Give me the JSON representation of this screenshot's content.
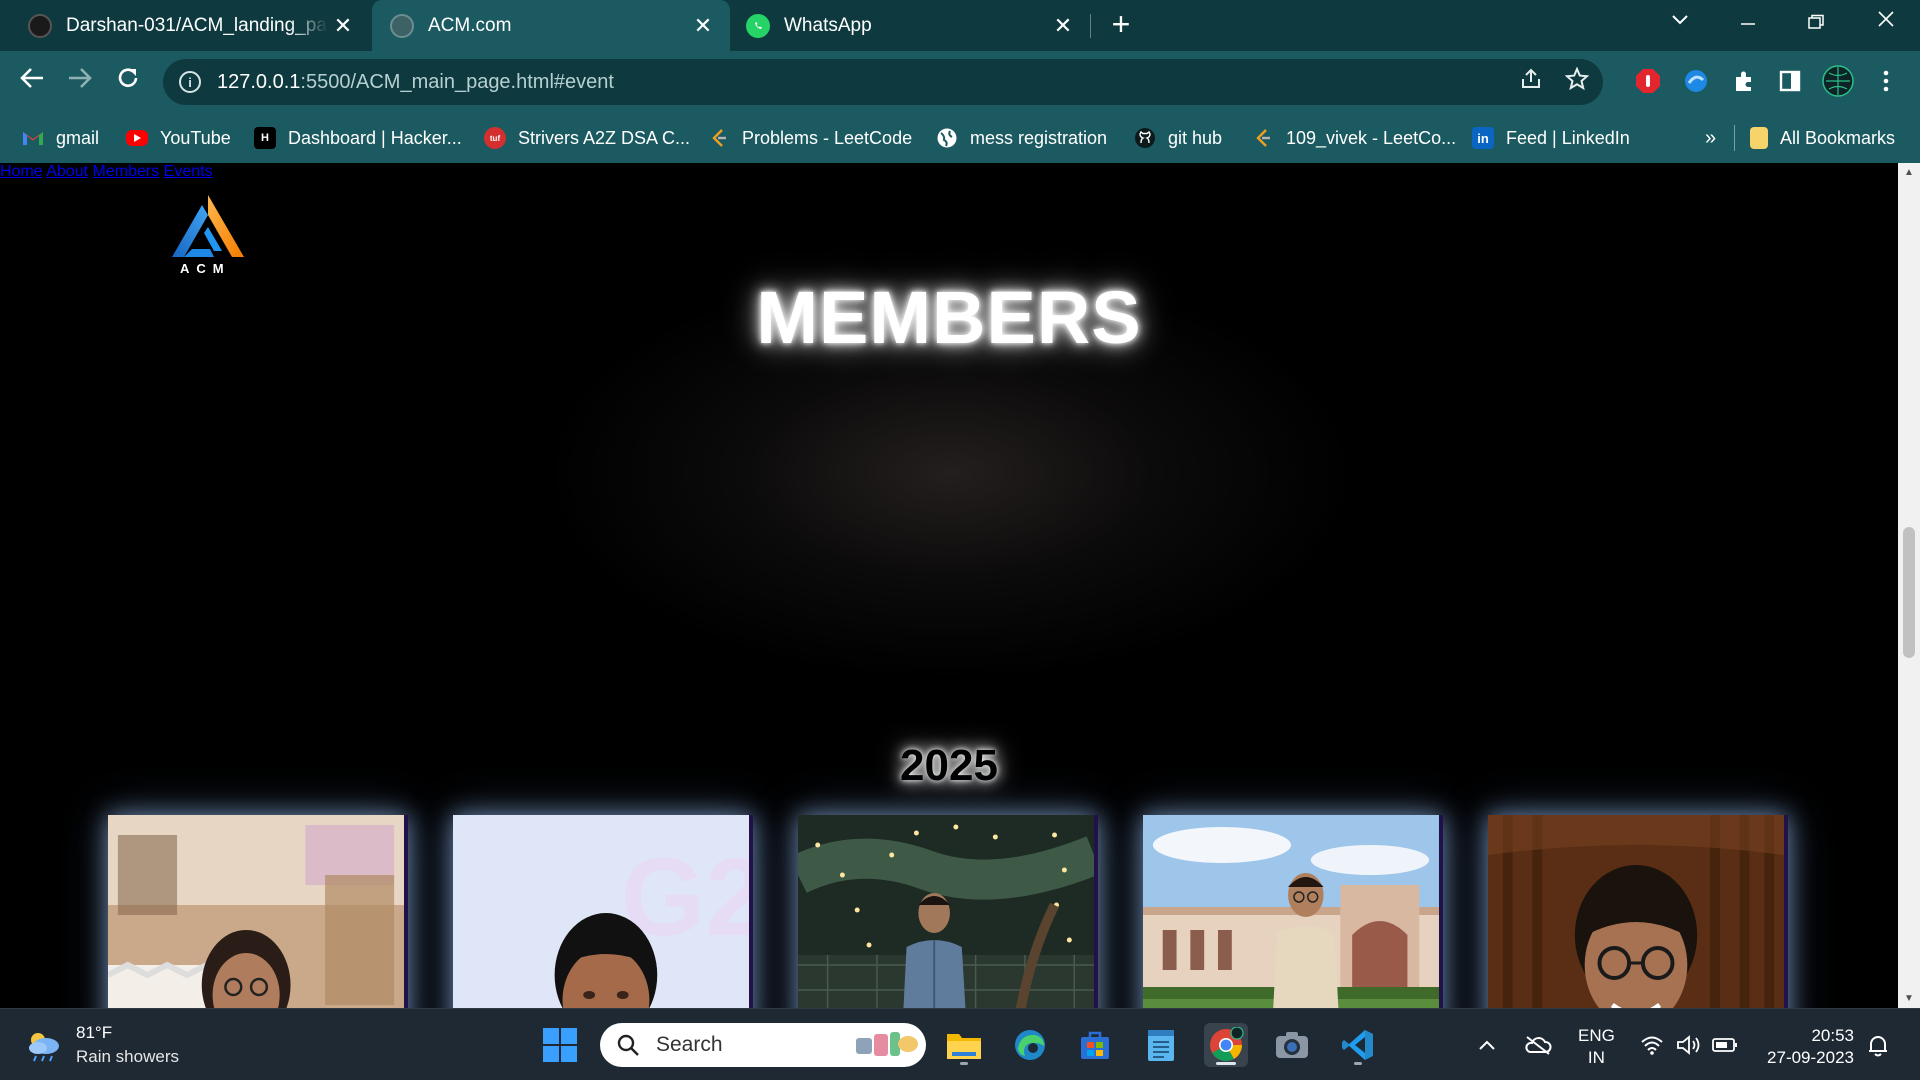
{
  "browser": {
    "tabs": [
      {
        "title": "Darshan-031/ACM_landing_page",
        "close": "✕",
        "active": false
      },
      {
        "title": "ACM.com",
        "close": "✕",
        "active": true
      },
      {
        "title": "WhatsApp",
        "close": "✕",
        "active": false
      }
    ],
    "new_tab": "+",
    "address": {
      "host": "127.0.0.1",
      "path": ":5500/ACM_main_page.html#event"
    },
    "bookmarks": [
      {
        "label": "gmail",
        "icon": "gmail-icon"
      },
      {
        "label": "YouTube",
        "icon": "youtube-icon"
      },
      {
        "label": "Dashboard | Hacker...",
        "icon": "hackerrank-icon"
      },
      {
        "label": "Strivers A2Z DSA C...",
        "icon": "tuf-icon"
      },
      {
        "label": "Problems - LeetCode",
        "icon": "leetcode-icon"
      },
      {
        "label": "mess registration",
        "icon": "globe-icon"
      },
      {
        "label": "git hub",
        "icon": "github-icon"
      },
      {
        "label": "109_vivek - LeetCo...",
        "icon": "leetcode-icon"
      },
      {
        "label": "Feed | LinkedIn",
        "icon": "linkedin-icon"
      }
    ],
    "more_bookmarks": "»",
    "all_bookmarks": "All Bookmarks"
  },
  "site": {
    "logo_text": "ACM",
    "nav": [
      "Home",
      "About",
      "Members",
      "Events"
    ],
    "section_title": "MEMBERS",
    "year": "2025",
    "member_cards": [
      {
        "photo": "woman-with-glasses-photo"
      },
      {
        "photo": "man-light-background-photo"
      },
      {
        "photo": "man-fairy-lights-photo"
      },
      {
        "photo": "man-campus-building-photo"
      },
      {
        "photo": "man-glasses-curtain-photo"
      }
    ]
  },
  "taskbar": {
    "weather_temp": "81°F",
    "weather_desc": "Rain showers",
    "search_placeholder": "Search",
    "lang_line1": "ENG",
    "lang_line2": "IN",
    "time": "20:53",
    "date": "27-09-2023"
  },
  "colors": {
    "chrome_dark": "#0e3a3f",
    "chrome_light": "#1c5a61",
    "page_bg": "#000000",
    "taskbar_bg": "#1f2933"
  }
}
